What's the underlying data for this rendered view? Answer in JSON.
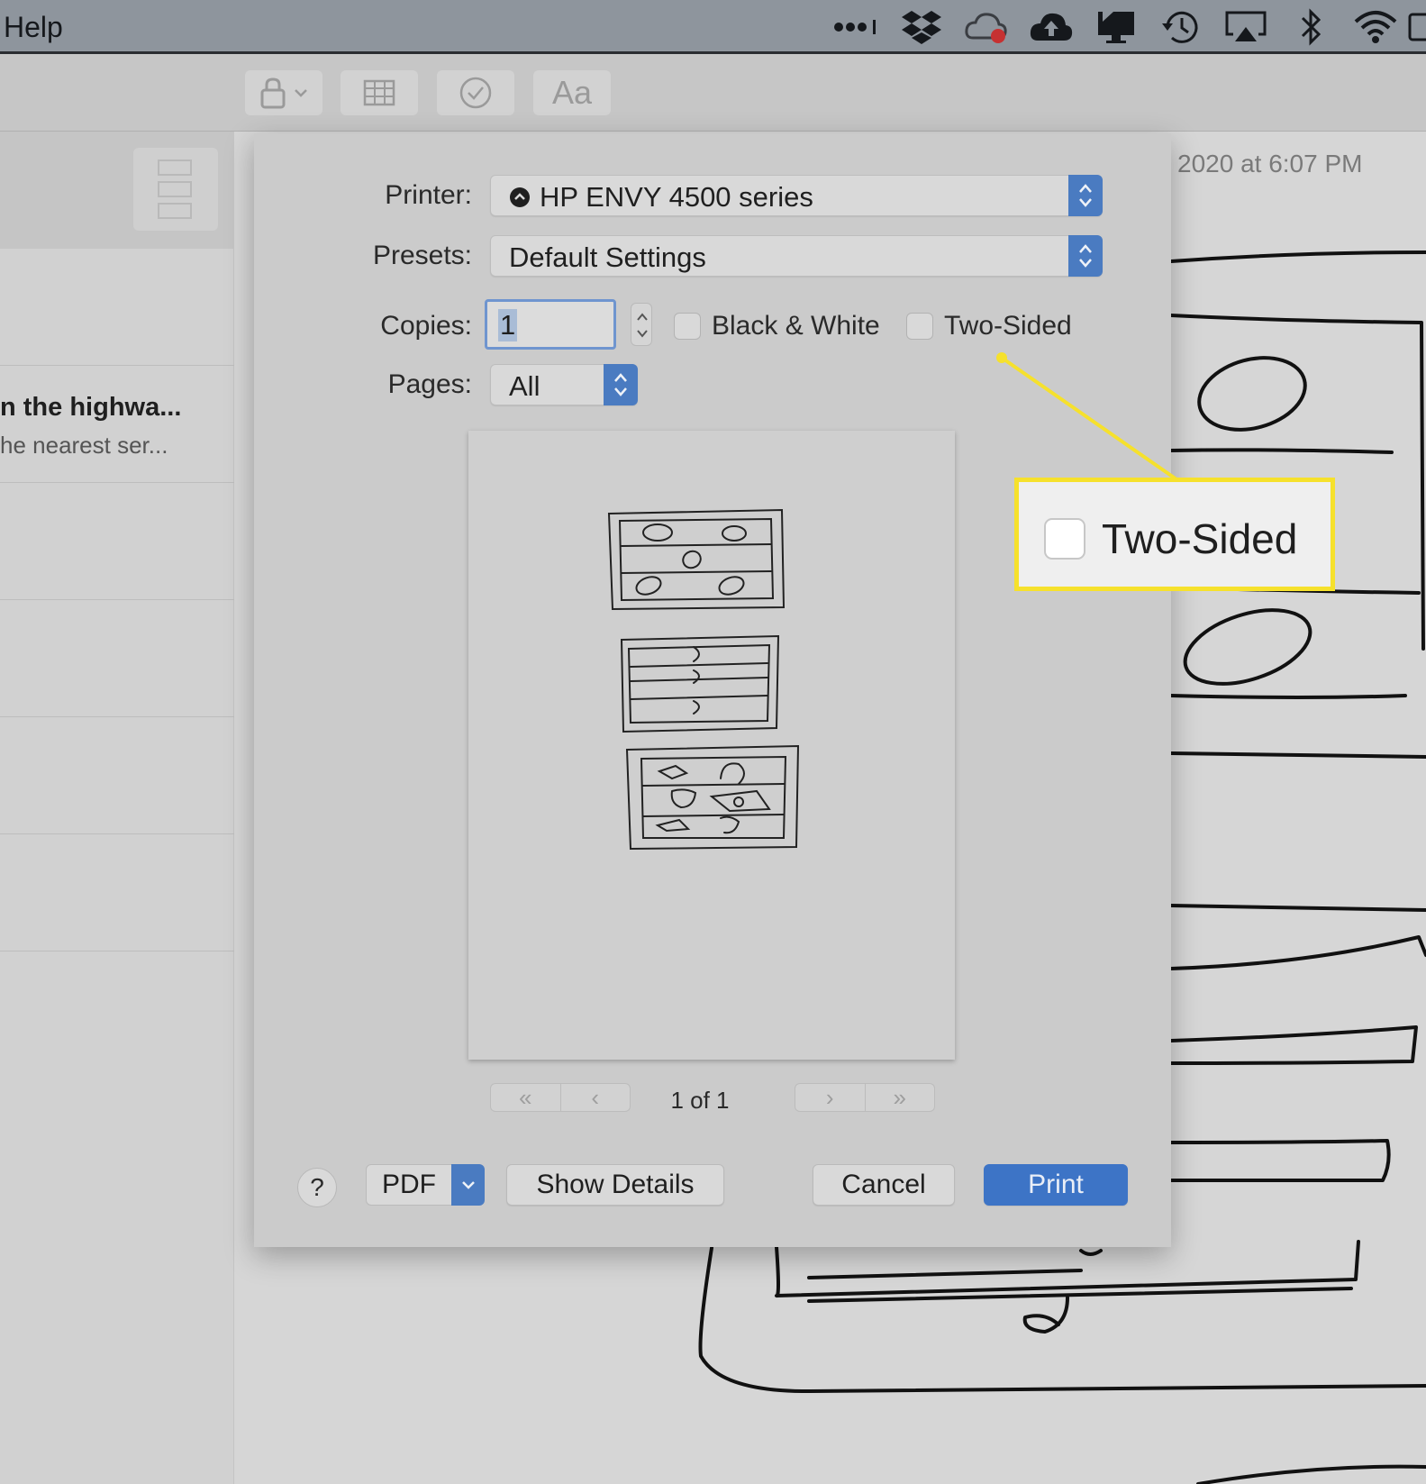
{
  "menubar": {
    "help_label": "Help",
    "status_icons": [
      "signal-icon",
      "dropbox-icon",
      "creative-cloud-icon",
      "cloud-upload-icon",
      "display-icon",
      "time-machine-icon",
      "airplay-icon",
      "bluetooth-icon",
      "wifi-icon",
      "battery-icon"
    ]
  },
  "toolbar": {
    "buttons": [
      "lock-icon",
      "table-icon",
      "checklist-icon",
      "format-text-button"
    ],
    "format_label": "Aa"
  },
  "sidebar": {
    "notes": [
      {
        "title": "n the highwa...",
        "snippet": "he nearest ser..."
      }
    ]
  },
  "note": {
    "date_text": "2020 at 6:07 PM"
  },
  "dialog": {
    "printer_label": "Printer:",
    "printer_value": "HP ENVY 4500 series",
    "presets_label": "Presets:",
    "presets_value": "Default Settings",
    "copies_label": "Copies:",
    "copies_value": "1",
    "black_white_label": "Black & White",
    "two_sided_label": "Two-Sided",
    "pages_label": "Pages:",
    "pages_value": "All",
    "page_indicator": "1 of 1",
    "help_label": "?",
    "pdf_label": "PDF",
    "show_details_label": "Show Details",
    "cancel_label": "Cancel",
    "print_label": "Print"
  },
  "callout": {
    "label": "Two-Sided"
  },
  "colors": {
    "accent_blue": "#3d74c6",
    "callout_yellow": "#f6e12c"
  }
}
